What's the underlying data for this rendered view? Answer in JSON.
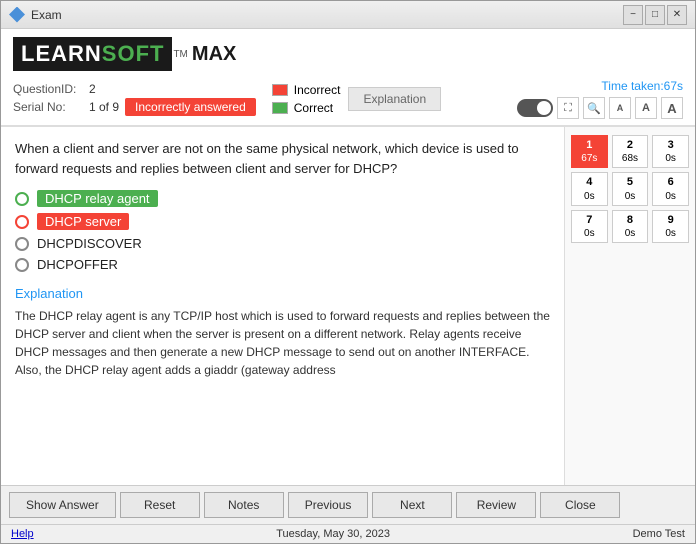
{
  "window": {
    "title": "Exam",
    "min_label": "−",
    "max_label": "□",
    "close_label": "✕"
  },
  "logo": {
    "learn": "LEARN",
    "soft": "SOFT",
    "max": "MAX",
    "tm": "TM"
  },
  "header": {
    "question_id_label": "QuestionID:",
    "question_id_value": "2",
    "serial_label": "Serial No:",
    "serial_value": "1 of 9",
    "incorrect_badge": "Incorrectly answered",
    "incorrect_legend": "Incorrect",
    "correct_legend": "Correct",
    "explanation_btn": "Explanation",
    "time_label": "Time taken:67s"
  },
  "question": {
    "text": "When a client and server are not on the same physical network, which device is used to forward\nrequests and replies between client and server for DHCP?",
    "options": [
      {
        "label": "DHCP relay agent",
        "state": "correct"
      },
      {
        "label": "DHCP server",
        "state": "incorrect"
      },
      {
        "label": "DHCPDISCOVER",
        "state": "normal"
      },
      {
        "label": "DHCPOFFER",
        "state": "normal"
      }
    ]
  },
  "explanation": {
    "title": "Explanation",
    "text": "The DHCP relay agent is any TCP/IP host which is used to forward requests and replies between the DHCP server and client when the server is present on a different network. Relay agents receive DHCP messages and then generate a new DHCP message to send out on another INTERFACE. Also, the DHCP relay agent adds a giaddr (gateway address"
  },
  "question_grid": [
    {
      "num": "1",
      "time": "67s",
      "active": true
    },
    {
      "num": "2",
      "time": "68s",
      "active": false
    },
    {
      "num": "3",
      "time": "0s",
      "active": false
    },
    {
      "num": "4",
      "time": "0s",
      "active": false
    },
    {
      "num": "5",
      "time": "0s",
      "active": false
    },
    {
      "num": "6",
      "time": "0s",
      "active": false
    },
    {
      "num": "7",
      "time": "0s",
      "active": false
    },
    {
      "num": "8",
      "time": "0s",
      "active": false
    },
    {
      "num": "9",
      "time": "0s",
      "active": false
    }
  ],
  "toolbar": {
    "show_answer_label": "Show Answer",
    "reset_label": "Reset",
    "notes_label": "Notes",
    "previous_label": "Previous",
    "next_label": "Next",
    "review_label": "Review",
    "close_label": "Close"
  },
  "status_bar": {
    "help": "Help",
    "date": "Tuesday, May 30, 2023",
    "mode": "Demo Test"
  }
}
